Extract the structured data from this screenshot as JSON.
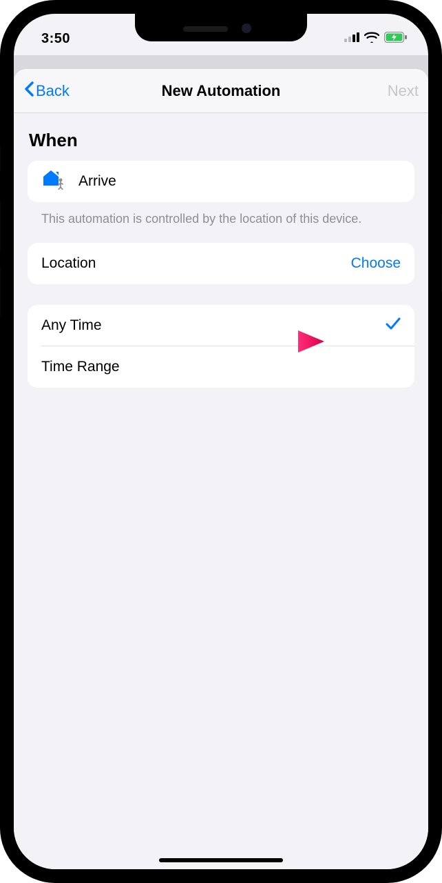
{
  "status": {
    "time": "3:50"
  },
  "nav": {
    "back": "Back",
    "title": "New Automation",
    "next": "Next"
  },
  "section": {
    "when": "When"
  },
  "arrive": {
    "label": "Arrive"
  },
  "footnote": "This automation is controlled by the location of this device.",
  "location": {
    "label": "Location",
    "action": "Choose"
  },
  "time_options": {
    "any": "Any Time",
    "range": "Time Range"
  }
}
